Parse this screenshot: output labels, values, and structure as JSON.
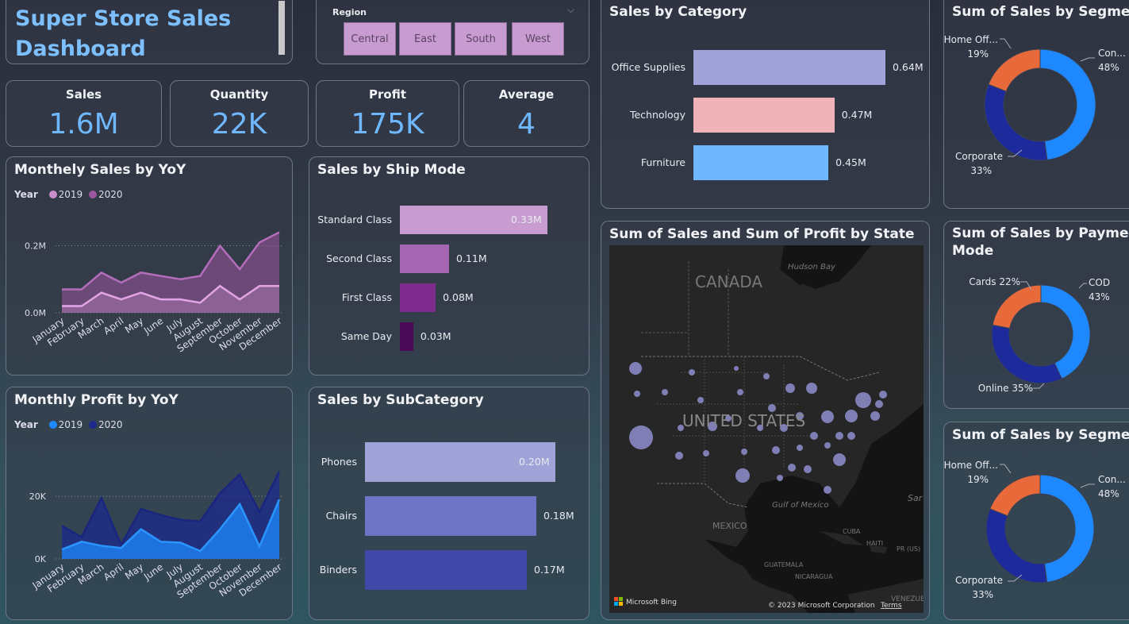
{
  "title": "Super Store Sales Dashboard",
  "slicer": {
    "label": "Region",
    "options": [
      "Central",
      "East",
      "South",
      "West"
    ]
  },
  "kpis": [
    {
      "label": "Sales",
      "value": "1.6M"
    },
    {
      "label": "Quantity",
      "value": "22K"
    },
    {
      "label": "Profit",
      "value": "175K"
    },
    {
      "label": "Average",
      "value": "4"
    }
  ],
  "colors": {
    "kpi_value": "#6fb8ff",
    "sales_2019": "#c98fcc",
    "sales_2020": "#9a569f",
    "profit_2019": "#1e88ff",
    "profit_2020": "#1c2a8c"
  },
  "monthly_sales": {
    "title": "Monthely Sales by YoY",
    "legend_title": "Year",
    "chart_data": {
      "type": "area",
      "x": [
        "January",
        "February",
        "March",
        "April",
        "May",
        "June",
        "July",
        "August",
        "September",
        "October",
        "November",
        "December"
      ],
      "y_ticks": [
        "0.0M",
        "0.2M"
      ],
      "ylim": [
        0,
        0.27
      ],
      "series": [
        {
          "name": "2019",
          "values": [
            0.02,
            0.02,
            0.06,
            0.04,
            0.06,
            0.04,
            0.04,
            0.03,
            0.08,
            0.04,
            0.08,
            0.08
          ]
        },
        {
          "name": "2020",
          "values": [
            0.07,
            0.07,
            0.12,
            0.09,
            0.12,
            0.11,
            0.1,
            0.11,
            0.2,
            0.13,
            0.21,
            0.24
          ]
        }
      ]
    }
  },
  "monthly_profit": {
    "title": "Monthly Profit by YoY",
    "legend_title": "Year",
    "chart_data": {
      "type": "area",
      "x": [
        "January",
        "February",
        "March",
        "April",
        "May",
        "June",
        "July",
        "August",
        "September",
        "October",
        "November",
        "December"
      ],
      "y_ticks": [
        "0K",
        "20K"
      ],
      "ylim": [
        0,
        34000
      ],
      "series": [
        {
          "name": "2019",
          "values": [
            3000,
            5500,
            4200,
            3500,
            9500,
            5500,
            5200,
            2500,
            9500,
            17500,
            4000,
            19000
          ]
        },
        {
          "name": "2020",
          "values": [
            10500,
            7000,
            19500,
            4500,
            16000,
            14000,
            12500,
            12000,
            21000,
            27000,
            15000,
            28000
          ]
        }
      ]
    }
  },
  "ship_mode": {
    "title": "Sales by Ship Mode",
    "chart_data": {
      "type": "bar",
      "categories": [
        "Standard Class",
        "Second Class",
        "First Class",
        "Same Day"
      ],
      "values": [
        0.33,
        0.11,
        0.08,
        0.03
      ],
      "labels": [
        "0.33M",
        "0.11M",
        "0.08M",
        "0.03M"
      ],
      "colors": [
        "#c89cd0",
        "#a466b0",
        "#7e2c8e",
        "#4a0a55"
      ]
    }
  },
  "subcategory": {
    "title": "Sales by SubCategory",
    "chart_data": {
      "type": "bar",
      "categories": [
        "Phones",
        "Chairs",
        "Binders"
      ],
      "values": [
        0.2,
        0.18,
        0.17
      ],
      "labels": [
        "0.20M",
        "0.18M",
        "0.17M"
      ],
      "colors": [
        "#9fa3d8",
        "#6e75c6",
        "#4149a8"
      ]
    }
  },
  "category": {
    "title": "Sales by Category",
    "chart_data": {
      "type": "bar",
      "categories": [
        "Office Supplies",
        "Technology",
        "Furniture"
      ],
      "values": [
        0.64,
        0.47,
        0.45
      ],
      "labels": [
        "0.64M",
        "0.47M",
        "0.45M"
      ],
      "colors": [
        "#9fa3d8",
        "#efb3b8",
        "#6fb8ff"
      ]
    }
  },
  "map": {
    "title": "Sum of Sales and Sum of Profit by State",
    "labels": {
      "canada": "CANADA",
      "us": "UNITED STATES",
      "mexico": "MEXICO",
      "hudson": "Hudson Bay",
      "gulf": "Gulf of Mexico",
      "cuba": "CUBA",
      "haiti": "HAITI",
      "pr": "PR (US)",
      "guatemala": "GUATEMALA",
      "nicaragua": "NICARAGUA",
      "venezuela": "VENEZUE",
      "sar": "Sar"
    },
    "brand": "Microsoft Bing",
    "copyright": "© 2023 Microsoft Corporation",
    "terms": "Terms"
  },
  "segment_top": {
    "title": "Sum of Sales by Segment",
    "chart_data": {
      "type": "pie",
      "donut": true,
      "slices": [
        {
          "name": "Con...",
          "value": 48,
          "label": "48%",
          "color": "#1e88ff"
        },
        {
          "name": "Corporate",
          "value": 33,
          "label": "33%",
          "color": "#1c2a9c"
        },
        {
          "name": "Home Off...",
          "value": 19,
          "label": "19%",
          "color": "#e8693a"
        }
      ]
    }
  },
  "payment": {
    "title": "Sum of Sales by Payment Mode",
    "title_line1": "Sum of Sales by Payment",
    "title_line2": "Mode",
    "chart_data": {
      "type": "pie",
      "donut": true,
      "slices": [
        {
          "name": "COD",
          "value": 43,
          "label": "43%",
          "color": "#1e88ff"
        },
        {
          "name": "Online",
          "value": 35,
          "label": "35%",
          "color": "#1c2a9c"
        },
        {
          "name": "Cards",
          "value": 22,
          "label": "22%",
          "color": "#e8693a"
        }
      ]
    }
  },
  "segment_bottom": {
    "title": "Sum of Sales by Segment",
    "chart_data": {
      "type": "pie",
      "donut": true,
      "slices": [
        {
          "name": "Con...",
          "value": 48,
          "label": "48%",
          "color": "#1e88ff"
        },
        {
          "name": "Corporate",
          "value": 33,
          "label": "33%",
          "color": "#1c2a9c"
        },
        {
          "name": "Home Off...",
          "value": 19,
          "label": "19%",
          "color": "#e8693a"
        }
      ]
    }
  }
}
